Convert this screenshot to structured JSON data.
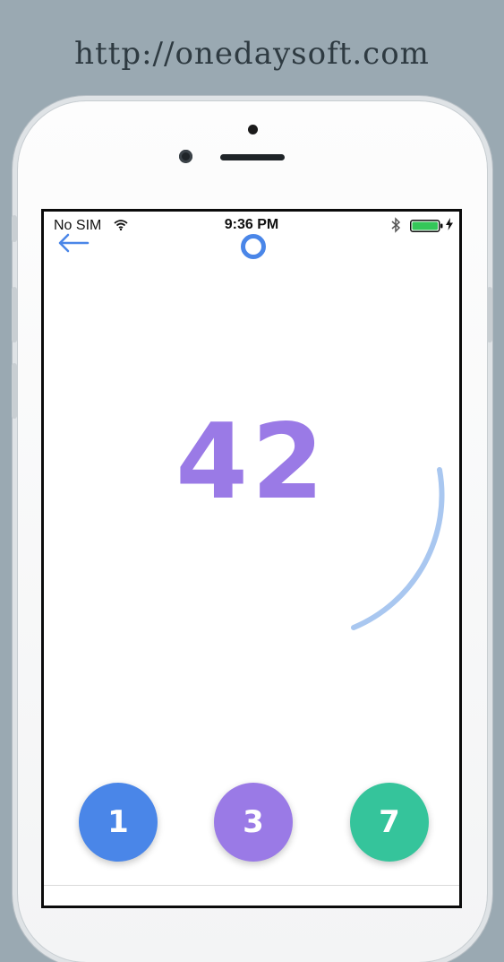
{
  "site_url": "http://onedaysoft.com",
  "status_bar": {
    "carrier": "No SIM",
    "time": "9:36 PM",
    "wifi_icon": "wifi-icon",
    "bluetooth_icon": "bluetooth-icon",
    "battery_icon": "battery-icon",
    "battery_level": 1.0,
    "battery_color": "#34c759"
  },
  "game": {
    "back_icon": "back-arrow-icon",
    "indicator_icon": "ring-indicator",
    "target_number": "42",
    "timer_arc_color": "#a9c7f0",
    "answers": [
      {
        "label": "1",
        "color": "#4a86e8"
      },
      {
        "label": "3",
        "color": "#9a7ae6"
      },
      {
        "label": "7",
        "color": "#35c49b"
      }
    ]
  },
  "colors": {
    "background": "#9aa9b2",
    "accent_blue": "#4a86e8",
    "accent_purple": "#9a7ae6",
    "accent_green": "#35c49b"
  }
}
